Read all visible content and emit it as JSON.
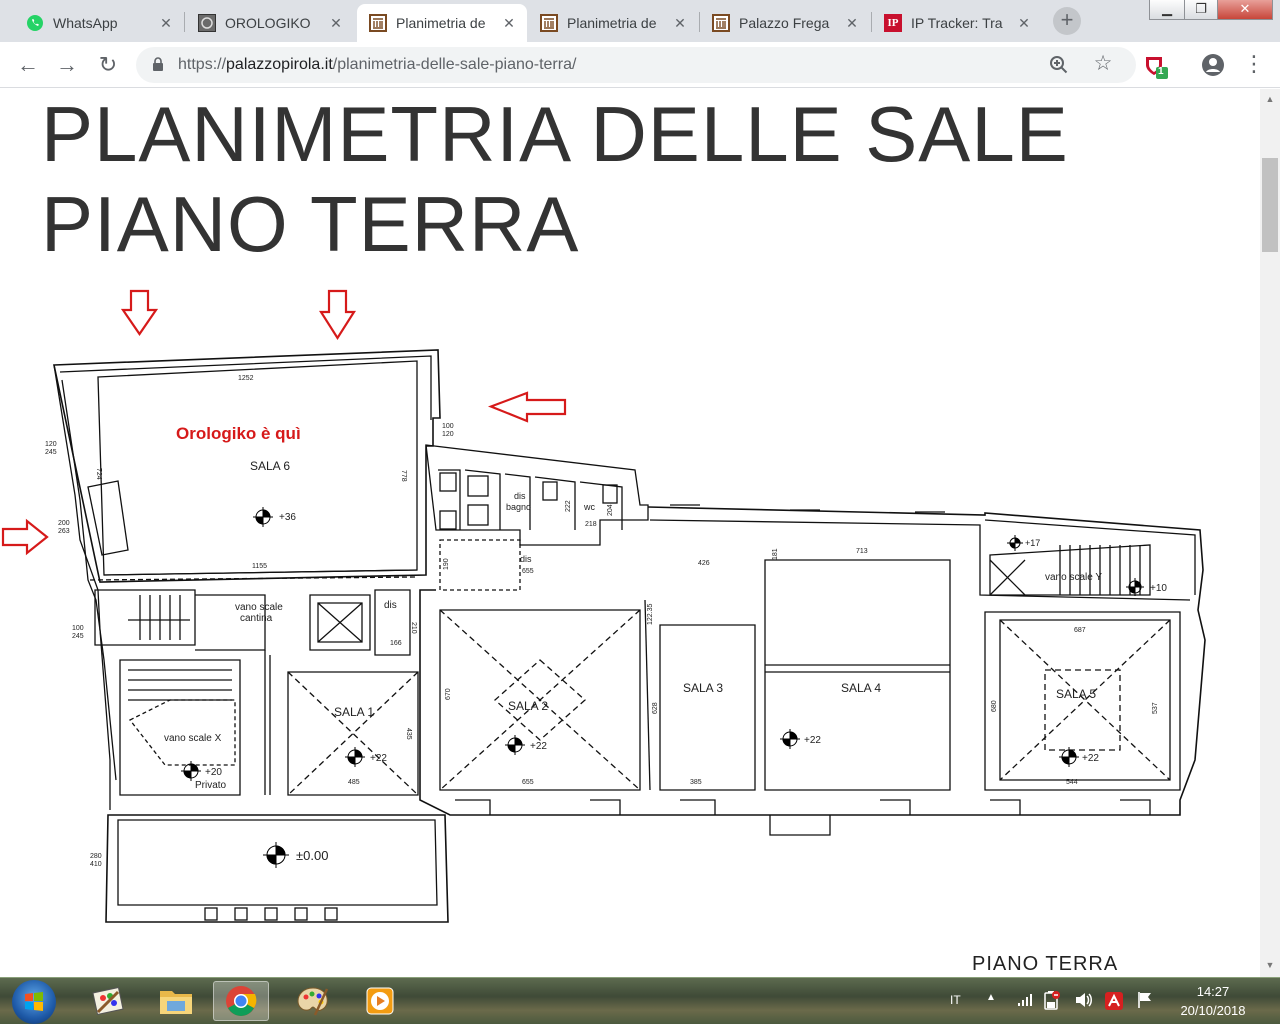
{
  "tabs": [
    {
      "title": "WhatsApp",
      "icon": "whatsapp-icon"
    },
    {
      "title": "OROLOGIKO",
      "icon": "orologiko-favicon-icon"
    },
    {
      "title": "Planimetria de",
      "icon": "palazzo-favicon-icon",
      "active": true
    },
    {
      "title": "Planimetria de",
      "icon": "palazzo-favicon-icon"
    },
    {
      "title": "Palazzo Frega",
      "icon": "palazzo-favicon-icon"
    },
    {
      "title": "IP Tracker: Tra",
      "icon": "ip-tracker-favicon-icon",
      "badge": "IP"
    }
  ],
  "address": {
    "scheme": "https://",
    "host": "palazzopirola.it",
    "path": "/planimetria-delle-sale-piano-terra/"
  },
  "extension_badge": "1",
  "page": {
    "title_line1": "PLANIMETRIA DELLE SALE",
    "title_line2": "PIANO TERRA"
  },
  "plan": {
    "annotation": "Orologiko è quì",
    "footer_label": "PIANO  TERRA",
    "rooms": [
      "SALA 6",
      "SALA 1",
      "SALA 2",
      "SALA 3",
      "SALA 4",
      "SALA 5"
    ],
    "labels": {
      "vano_scale_cantina_1": "vano scale",
      "vano_scale_cantina_2": "cantina",
      "vano_scale_x": "vano scale X",
      "privato": "Privato",
      "vano_scale_y": "vano scale Y",
      "dis_1": "dis",
      "dis_2": "dis",
      "dis_bagno_1": "dis",
      "dis_bagno_2": "bagno",
      "wc": "wc",
      "dis_3": "dis"
    },
    "levels": {
      "sala6": "+36",
      "sala1": "+22",
      "sala2": "+22",
      "sala4": "+22",
      "sala5": "+22",
      "privato": "+20",
      "entrance": "±0.00",
      "scale_y": "+10",
      "scale_y_top": "+17"
    },
    "dimensions": {
      "d1252": "1252",
      "d778": "778",
      "d1155": "1155",
      "d724": "724",
      "d485": "485",
      "d435": "435",
      "d655a": "655",
      "d655b": "655",
      "d670": "670",
      "d628": "628",
      "d385": "385",
      "d713": "713",
      "d426": "426",
      "d687": "687",
      "d680": "680",
      "d537": "537",
      "d544": "544",
      "d166": "166",
      "d210": "210",
      "d190": "190",
      "d181": "181",
      "d218": "218",
      "d204": "204",
      "d222": "222",
      "d2235": "122.35",
      "w100_120": "100\n120",
      "w120_245": "120\n245",
      "w200_263": "200\n263",
      "w100_245": "100\n245",
      "w280_410": "280\n410"
    }
  },
  "taskbar": {
    "items": [
      "windows-start-icon",
      "paint-icon",
      "file-explorer-icon",
      "chrome-icon",
      "paint-palette-icon",
      "media-player-icon"
    ],
    "language": "IT",
    "time": "14:27",
    "date": "20/10/2018"
  }
}
